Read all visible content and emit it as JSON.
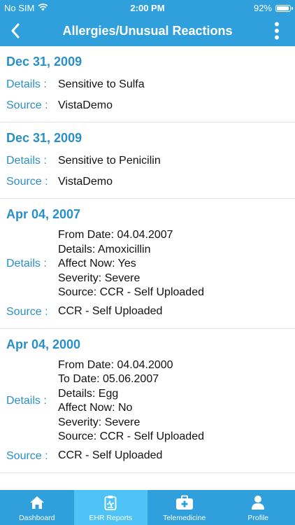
{
  "status_bar": {
    "carrier": "No SIM",
    "time": "2:00 PM",
    "battery": "92%",
    "battery_level": 0.92
  },
  "nav": {
    "title": "Allergies/Unusual Reactions"
  },
  "labels": {
    "details": "Details :",
    "source": "Source :"
  },
  "entries": [
    {
      "date": "Dec 31, 2009",
      "details": [
        "Sensitive to Sulfa"
      ],
      "source": "VistaDemo"
    },
    {
      "date": "Dec 31, 2009",
      "details": [
        "Sensitive to Penicilin"
      ],
      "source": "VistaDemo"
    },
    {
      "date": "Apr 04, 2007",
      "details": [
        "From Date: 04.04.2007",
        "Details: Amoxicillin",
        "Affect Now: Yes",
        "Severity: Severe",
        "Source: CCR - Self Uploaded"
      ],
      "source": "CCR - Self Uploaded"
    },
    {
      "date": "Apr 04, 2000",
      "details": [
        "From Date: 04.04.2000",
        "To Date: 05.06.2007",
        "Details: Egg",
        "Affect Now: No",
        "Severity: Severe",
        "Source: CCR - Self Uploaded"
      ],
      "source": "CCR - Self Uploaded"
    }
  ],
  "tabs": [
    {
      "label": "Dashboard",
      "icon": "home-icon",
      "active": false
    },
    {
      "label": "EHR Reports",
      "icon": "clipboard-icon",
      "active": true
    },
    {
      "label": "Telemedicine",
      "icon": "medical-kit-icon",
      "active": false
    },
    {
      "label": "Profile",
      "icon": "person-icon",
      "active": false
    }
  ]
}
